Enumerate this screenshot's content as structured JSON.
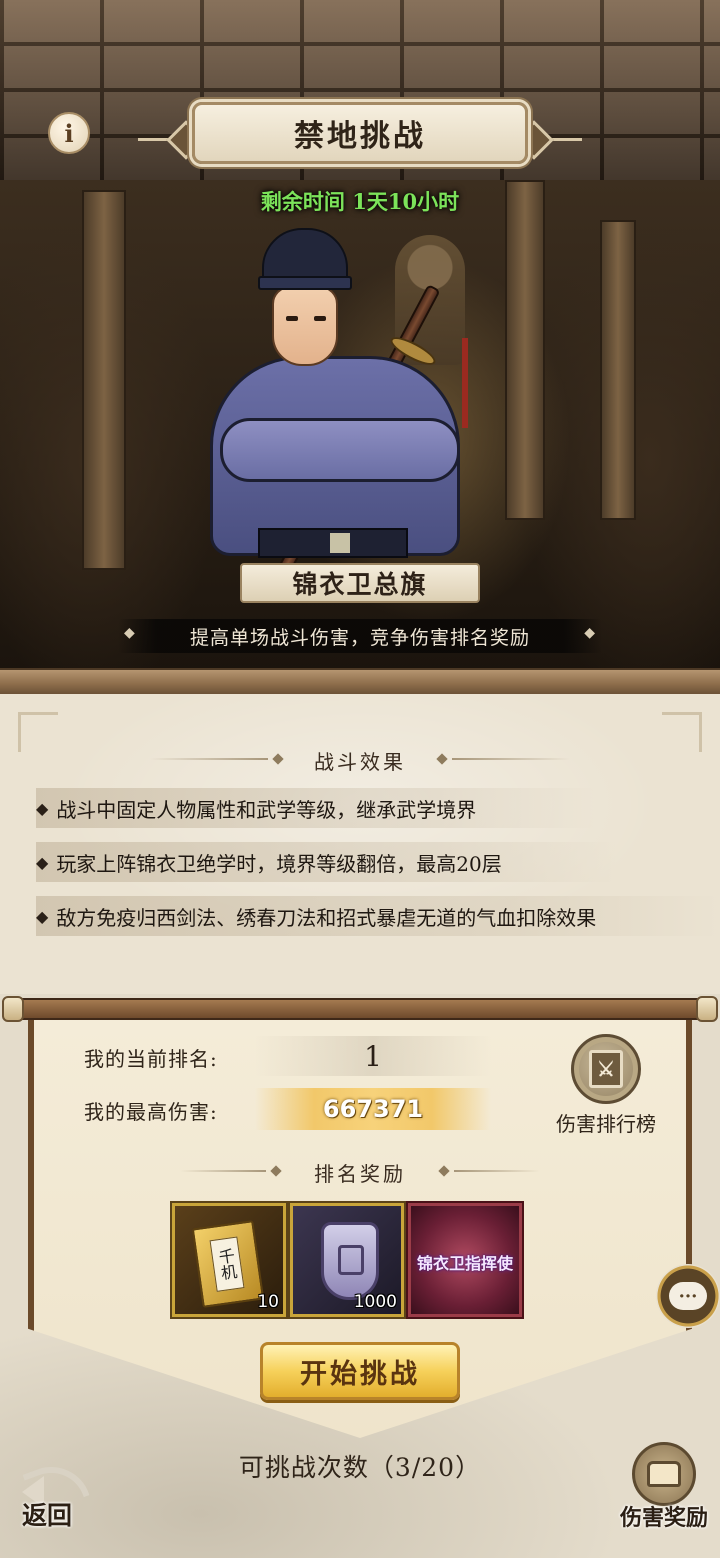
{
  "header": {
    "title": "禁地挑战",
    "timer": "剩余时间 1天10小时",
    "info_icon": "info-icon"
  },
  "boss": {
    "name": "锦衣卫总旗",
    "description": "提高单场战斗伤害，竞争伤害排名奖励"
  },
  "effects": {
    "title": "战斗效果",
    "items": [
      "战斗中固定人物属性和武学等级，继承武学境界",
      "玩家上阵锦衣卫绝学时，境界等级翻倍，最高20层",
      "敌方免疫归西剑法、绣春刀法和招式暴虐无道的气血扣除效果"
    ]
  },
  "stats": {
    "rank_label": "我的当前排名:",
    "rank_value": "1",
    "damage_label": "我的最高伤害:",
    "damage_value": "667371",
    "leaderboard_label": "伤害排行榜"
  },
  "rewards": {
    "title": "排名奖励",
    "items": [
      {
        "icon": "book-icon",
        "art_text": "千机",
        "count": "10"
      },
      {
        "icon": "token-icon",
        "count": "1000"
      },
      {
        "icon": "title-badge-icon",
        "text": "锦衣卫指挥使"
      }
    ]
  },
  "actions": {
    "start_label": "开始挑战",
    "attempts": "可挑战次数（3/20）",
    "back_label": "返回",
    "damage_reward_label": "伤害奖励"
  },
  "colors": {
    "timer": "#7ce35a",
    "gold_button": "#f6d15b",
    "panel": "#efe4cb"
  }
}
